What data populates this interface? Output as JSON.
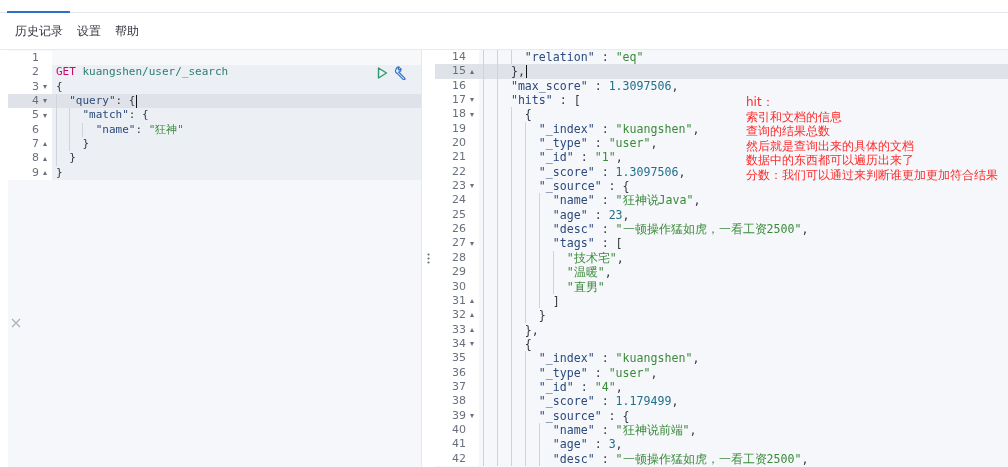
{
  "menu": [
    {
      "label": "历史记录"
    },
    {
      "label": "设置"
    },
    {
      "label": "帮助"
    }
  ],
  "request_editor": {
    "lines": [
      {
        "number": "1",
        "in_request": false,
        "active": false
      },
      {
        "number": "2",
        "in_request": true,
        "active": false,
        "tokens": [
          {
            "kind": "method",
            "text": "GET"
          },
          {
            "kind": "url",
            "text": "kuangshen/user/_search"
          }
        ]
      },
      {
        "number": "3",
        "fold": "▾",
        "in_request": true,
        "active": false,
        "tokens": [
          {
            "kind": "punct",
            "text": "{"
          }
        ]
      },
      {
        "number": "4",
        "fold": "▾",
        "in_request": true,
        "active": true,
        "tokens": [
          {
            "kind": "key",
            "text": "  \"query\""
          },
          {
            "kind": "punct",
            "text": ": {"
          }
        ]
      },
      {
        "number": "5",
        "fold": "▾",
        "in_request": true,
        "active": false,
        "tokens": [
          {
            "kind": "key",
            "text": "    \"match\""
          },
          {
            "kind": "punct",
            "text": ": {"
          }
        ]
      },
      {
        "number": "6",
        "in_request": true,
        "active": false,
        "tokens": [
          {
            "kind": "key",
            "text": "      \"name\""
          },
          {
            "kind": "punct",
            "text": ": "
          },
          {
            "kind": "string",
            "text": "\"狂神\""
          }
        ]
      },
      {
        "number": "7",
        "fold": "▴",
        "in_request": true,
        "active": false,
        "tokens": [
          {
            "kind": "punct",
            "text": "    }"
          }
        ]
      },
      {
        "number": "8",
        "fold": "▴",
        "in_request": true,
        "active": false,
        "tokens": [
          {
            "kind": "punct",
            "text": "  }"
          }
        ]
      },
      {
        "number": "9",
        "fold": "▴",
        "in_request": true,
        "active": false,
        "tokens": [
          {
            "kind": "punct",
            "text": "}"
          }
        ]
      }
    ]
  },
  "response_editor": {
    "lines": [
      {
        "number": "14",
        "active": false,
        "tokens": [
          {
            "kind": "key",
            "text": "      \"relation\""
          },
          {
            "kind": "punct",
            "text": " : "
          },
          {
            "kind": "string",
            "text": "\"eq\""
          }
        ]
      },
      {
        "number": "15",
        "fold": "▴",
        "active": true,
        "tokens": [
          {
            "kind": "punct",
            "text": "    },"
          }
        ]
      },
      {
        "number": "16",
        "active": false,
        "tokens": [
          {
            "kind": "key",
            "text": "    \"max_score\""
          },
          {
            "kind": "punct",
            "text": " : "
          },
          {
            "kind": "number",
            "text": "1.3097506"
          },
          {
            "kind": "punct",
            "text": ","
          }
        ]
      },
      {
        "number": "17",
        "fold": "▾",
        "active": false,
        "tokens": [
          {
            "kind": "key",
            "text": "    \"hits\""
          },
          {
            "kind": "punct",
            "text": " : ["
          }
        ]
      },
      {
        "number": "18",
        "fold": "▾",
        "active": false,
        "tokens": [
          {
            "kind": "punct",
            "text": "      {"
          }
        ]
      },
      {
        "number": "19",
        "active": false,
        "tokens": [
          {
            "kind": "key",
            "text": "        \"_index\""
          },
          {
            "kind": "punct",
            "text": " : "
          },
          {
            "kind": "string",
            "text": "\"kuangshen\""
          },
          {
            "kind": "punct",
            "text": ","
          }
        ]
      },
      {
        "number": "20",
        "active": false,
        "tokens": [
          {
            "kind": "key",
            "text": "        \"_type\""
          },
          {
            "kind": "punct",
            "text": " : "
          },
          {
            "kind": "string",
            "text": "\"user\""
          },
          {
            "kind": "punct",
            "text": ","
          }
        ]
      },
      {
        "number": "21",
        "active": false,
        "tokens": [
          {
            "kind": "key",
            "text": "        \"_id\""
          },
          {
            "kind": "punct",
            "text": " : "
          },
          {
            "kind": "string",
            "text": "\"1\""
          },
          {
            "kind": "punct",
            "text": ","
          }
        ]
      },
      {
        "number": "22",
        "active": false,
        "tokens": [
          {
            "kind": "key",
            "text": "        \"_score\""
          },
          {
            "kind": "punct",
            "text": " : "
          },
          {
            "kind": "number",
            "text": "1.3097506"
          },
          {
            "kind": "punct",
            "text": ","
          }
        ]
      },
      {
        "number": "23",
        "fold": "▾",
        "active": false,
        "tokens": [
          {
            "kind": "key",
            "text": "        \"_source\""
          },
          {
            "kind": "punct",
            "text": " : {"
          }
        ]
      },
      {
        "number": "24",
        "active": false,
        "tokens": [
          {
            "kind": "key",
            "text": "          \"name\""
          },
          {
            "kind": "punct",
            "text": " : "
          },
          {
            "kind": "string",
            "text": "\"狂神说Java\""
          },
          {
            "kind": "punct",
            "text": ","
          }
        ]
      },
      {
        "number": "25",
        "active": false,
        "tokens": [
          {
            "kind": "key",
            "text": "          \"age\""
          },
          {
            "kind": "punct",
            "text": " : "
          },
          {
            "kind": "number",
            "text": "23"
          },
          {
            "kind": "punct",
            "text": ","
          }
        ]
      },
      {
        "number": "26",
        "active": false,
        "tokens": [
          {
            "kind": "key",
            "text": "          \"desc\""
          },
          {
            "kind": "punct",
            "text": " : "
          },
          {
            "kind": "string",
            "text": "\"一顿操作猛如虎，一看工资2500\""
          },
          {
            "kind": "punct",
            "text": ","
          }
        ]
      },
      {
        "number": "27",
        "fold": "▾",
        "active": false,
        "tokens": [
          {
            "kind": "key",
            "text": "          \"tags\""
          },
          {
            "kind": "punct",
            "text": " : ["
          }
        ]
      },
      {
        "number": "28",
        "active": false,
        "tokens": [
          {
            "kind": "string",
            "text": "            \"技术宅\""
          },
          {
            "kind": "punct",
            "text": ","
          }
        ]
      },
      {
        "number": "29",
        "active": false,
        "tokens": [
          {
            "kind": "string",
            "text": "            \"温暖\""
          },
          {
            "kind": "punct",
            "text": ","
          }
        ]
      },
      {
        "number": "30",
        "active": false,
        "tokens": [
          {
            "kind": "string",
            "text": "            \"直男\""
          }
        ]
      },
      {
        "number": "31",
        "fold": "▴",
        "active": false,
        "tokens": [
          {
            "kind": "punct",
            "text": "          ]"
          }
        ]
      },
      {
        "number": "32",
        "fold": "▴",
        "active": false,
        "tokens": [
          {
            "kind": "punct",
            "text": "        }"
          }
        ]
      },
      {
        "number": "33",
        "fold": "▴",
        "active": false,
        "tokens": [
          {
            "kind": "punct",
            "text": "      },"
          }
        ]
      },
      {
        "number": "34",
        "fold": "▾",
        "active": false,
        "tokens": [
          {
            "kind": "punct",
            "text": "      {"
          }
        ]
      },
      {
        "number": "35",
        "active": false,
        "tokens": [
          {
            "kind": "key",
            "text": "        \"_index\""
          },
          {
            "kind": "punct",
            "text": " : "
          },
          {
            "kind": "string",
            "text": "\"kuangshen\""
          },
          {
            "kind": "punct",
            "text": ","
          }
        ]
      },
      {
        "number": "36",
        "active": false,
        "tokens": [
          {
            "kind": "key",
            "text": "        \"_type\""
          },
          {
            "kind": "punct",
            "text": " : "
          },
          {
            "kind": "string",
            "text": "\"user\""
          },
          {
            "kind": "punct",
            "text": ","
          }
        ]
      },
      {
        "number": "37",
        "active": false,
        "tokens": [
          {
            "kind": "key",
            "text": "        \"_id\""
          },
          {
            "kind": "punct",
            "text": " : "
          },
          {
            "kind": "string",
            "text": "\"4\""
          },
          {
            "kind": "punct",
            "text": ","
          }
        ]
      },
      {
        "number": "38",
        "active": false,
        "tokens": [
          {
            "kind": "key",
            "text": "        \"_score\""
          },
          {
            "kind": "punct",
            "text": " : "
          },
          {
            "kind": "number",
            "text": "1.179499"
          },
          {
            "kind": "punct",
            "text": ","
          }
        ]
      },
      {
        "number": "39",
        "fold": "▾",
        "active": false,
        "tokens": [
          {
            "kind": "key",
            "text": "        \"_source\""
          },
          {
            "kind": "punct",
            "text": " : {"
          }
        ]
      },
      {
        "number": "40",
        "active": false,
        "tokens": [
          {
            "kind": "key",
            "text": "          \"name\""
          },
          {
            "kind": "punct",
            "text": " : "
          },
          {
            "kind": "string",
            "text": "\"狂神说前端\""
          },
          {
            "kind": "punct",
            "text": ","
          }
        ]
      },
      {
        "number": "41",
        "active": false,
        "tokens": [
          {
            "kind": "key",
            "text": "          \"age\""
          },
          {
            "kind": "punct",
            "text": " : "
          },
          {
            "kind": "number",
            "text": "3"
          },
          {
            "kind": "punct",
            "text": ","
          }
        ]
      },
      {
        "number": "42",
        "active": false,
        "tokens": [
          {
            "kind": "key",
            "text": "          \"desc\""
          },
          {
            "kind": "punct",
            "text": " : "
          },
          {
            "kind": "string",
            "text": "\"一顿操作猛如虎，一看工资2500\""
          },
          {
            "kind": "punct",
            "text": ","
          }
        ]
      }
    ]
  },
  "annotation": [
    "hit：",
    "索引和文档的信息",
    "查询的结果总数",
    "然后就是查询出来的具体的文档",
    "数据中的东西都可以遍历出来了",
    "分数：我们可以通过来判断谁更加更加符合结果"
  ]
}
